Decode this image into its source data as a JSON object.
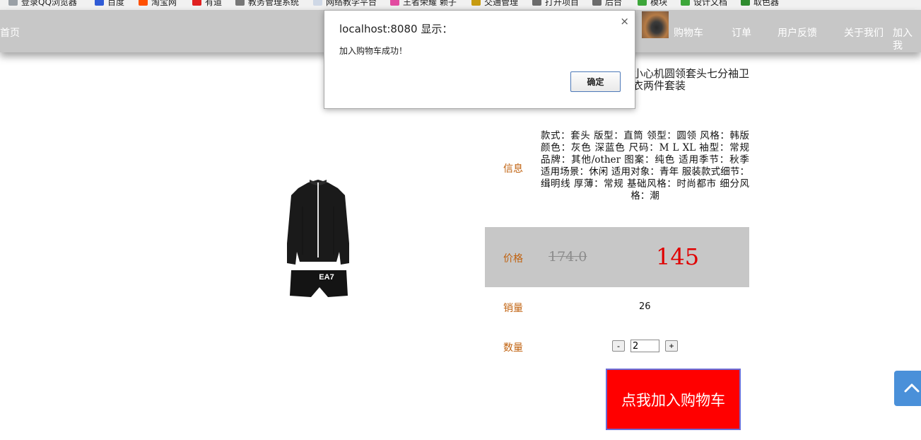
{
  "bookmarks": [
    {
      "label": "登录QQ浏览器",
      "icon": "qq-icon",
      "color": "#9aa0a6"
    },
    {
      "label": "百度",
      "icon": "baidu-icon",
      "color": "#2f5bd6"
    },
    {
      "label": "淘宝网",
      "icon": "taobao-icon",
      "color": "#ff5000"
    },
    {
      "label": "有道",
      "icon": "youdao-icon",
      "color": "#e02020"
    },
    {
      "label": "教务管理系统",
      "icon": "globe-icon",
      "color": "#777777"
    },
    {
      "label": "网络教学平台",
      "icon": "page-icon",
      "color": "#cfd8e6"
    },
    {
      "label": "王者荣耀 赖子",
      "icon": "game-icon",
      "color": "#e24aa0"
    },
    {
      "label": "交通管理",
      "icon": "traffic-icon",
      "color": "#c79b10"
    },
    {
      "label": "打开项目",
      "icon": "image-icon",
      "color": "#6b6b6b"
    },
    {
      "label": "后台",
      "icon": "image-icon",
      "color": "#6b6b6b"
    },
    {
      "label": "模块",
      "icon": "leaf-icon",
      "color": "#3da63a"
    },
    {
      "label": "设计文档",
      "icon": "leaf-icon",
      "color": "#3da63a"
    },
    {
      "label": "取色器",
      "icon": "picker-icon",
      "color": "#2e8b2e"
    }
  ],
  "nav": {
    "home": "首页",
    "cart": "购物车",
    "orders": "订单",
    "feedback": "用户反馈",
    "about": "关于我们",
    "join": "加入我"
  },
  "product": {
    "title": "小心机圆领套头七分袖卫衣两件套装",
    "info_label": "信息",
    "info": "款式：套头 版型：直筒 领型：圆领 风格：韩版 颜色：灰色 深蓝色 尺码：M L XL 袖型：常规 品牌：其他/other 图案：纯色 适用季节：秋季 适用场景：休闲 适用对象：青年 服装款式细节：缉明线 厚薄：常规 基础风格：时尚都市 细分风格：潮",
    "price_label": "价格",
    "old_price": "174.0",
    "new_price": "145",
    "sales_label": "销量",
    "sales": "26",
    "qty_label": "数量",
    "qty": "2",
    "minus": "-",
    "plus": "+",
    "add_to_cart": "点我加入购物车",
    "image_brand": "EA7"
  },
  "dialog": {
    "title": "localhost:8080 显示：",
    "message": "加入购物车成功！",
    "ok": "确定",
    "close": "×"
  },
  "colors": {
    "nav_bg": "#c7c7c7",
    "label": "#c0610e",
    "price": "#e00000",
    "cart_button": "#ff0000",
    "back_top": "#4a90d9"
  }
}
